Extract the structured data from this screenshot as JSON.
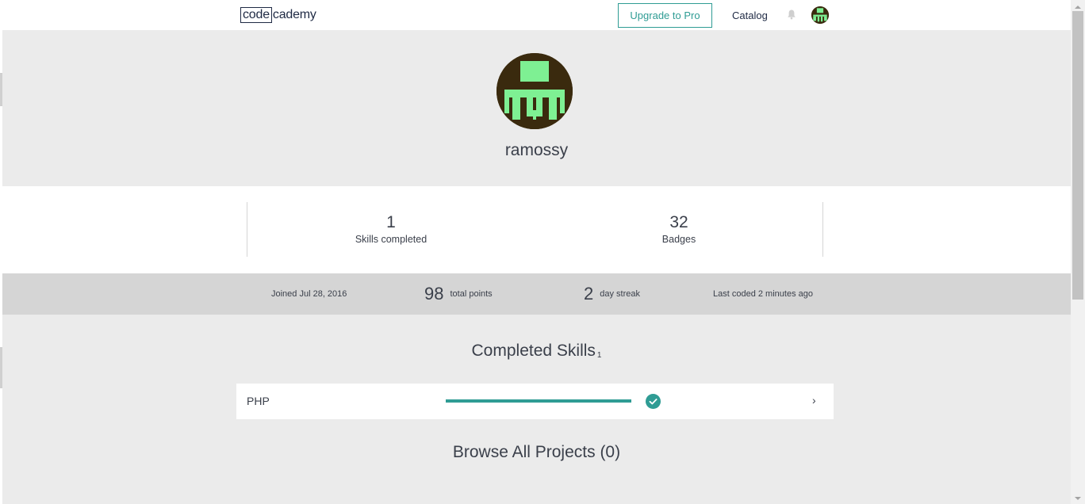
{
  "header": {
    "logo_left": "code",
    "logo_right": "cademy",
    "upgrade_label": "Upgrade to Pro",
    "catalog_label": "Catalog"
  },
  "profile": {
    "username": "ramossy"
  },
  "stats": {
    "skills": {
      "value": "1",
      "label": "Skills completed"
    },
    "badges": {
      "value": "32",
      "label": "Badges"
    }
  },
  "meta": {
    "joined": "Joined Jul 28, 2016",
    "points_value": "98",
    "points_label": "total points",
    "streak_value": "2",
    "streak_label": "day streak",
    "last_coded": "Last coded 2 minutes ago"
  },
  "completed_skills": {
    "title": "Completed Skills",
    "count": "1",
    "items": [
      {
        "name": "PHP",
        "progress": 1.0
      }
    ]
  },
  "projects": {
    "title": "Browse All Projects (0)"
  },
  "colors": {
    "accent": "#2f9c94",
    "avatar_bg": "#3a2a0e",
    "avatar_fg": "#7ef093"
  }
}
